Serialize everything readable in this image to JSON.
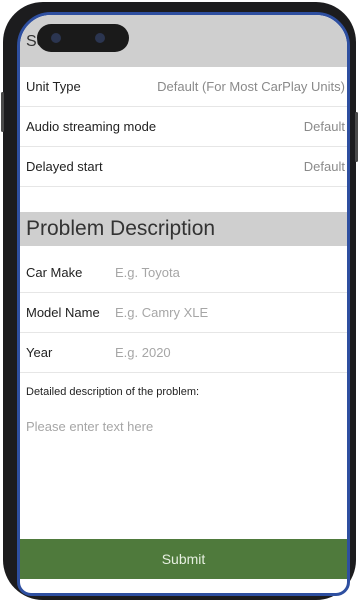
{
  "settings": {
    "header_title": "Settings",
    "rows": [
      {
        "label": "Unit Type",
        "value": "Default (For Most CarPlay Units)"
      },
      {
        "label": "Audio streaming mode",
        "value": "Default"
      },
      {
        "label": "Delayed start",
        "value": "Default"
      }
    ]
  },
  "problem": {
    "header_title": "Problem Description",
    "fields": [
      {
        "label": "Car Make",
        "placeholder": "E.g. Toyota"
      },
      {
        "label": "Model Name",
        "placeholder": "E.g. Camry XLE"
      },
      {
        "label": "Year",
        "placeholder": "E.g. 2020"
      }
    ],
    "detail_label": "Detailed description of the problem:",
    "detail_placeholder": "Please enter text here"
  },
  "submit_label": "Submit",
  "colors": {
    "header_bg": "#cfcfcf",
    "submit_bg": "#4f7a3c",
    "frame_accent": "#2e4fa0"
  }
}
